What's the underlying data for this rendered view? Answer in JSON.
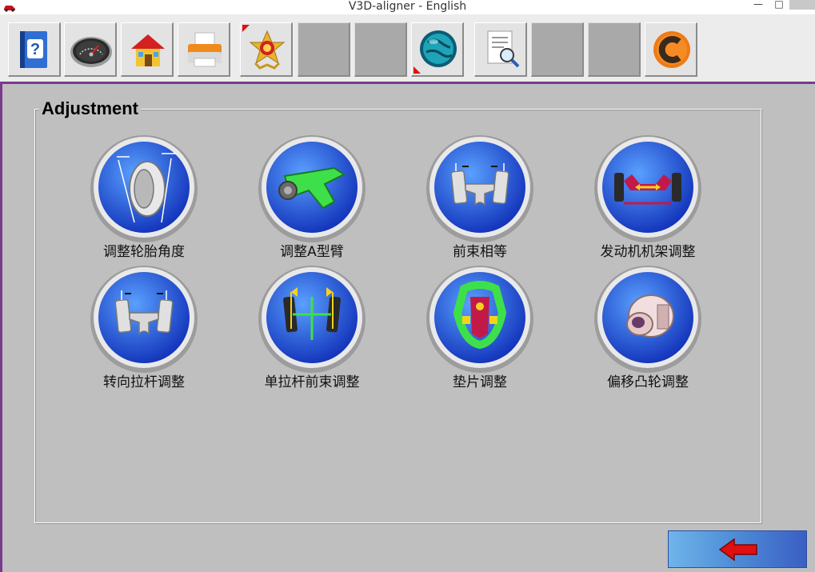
{
  "window": {
    "title": "V3D-aligner - English",
    "controls": {
      "minimize": "—",
      "maximize": "□",
      "close": ""
    }
  },
  "toolbar": {
    "buttons": [
      {
        "icon": "help-book-icon"
      },
      {
        "icon": "gauge-icon"
      },
      {
        "icon": "home-icon"
      },
      {
        "icon": "printer-icon"
      },
      {
        "icon": "badge-star-icon"
      },
      {
        "icon": "blank"
      },
      {
        "icon": "blank"
      },
      {
        "icon": "globe-icon"
      },
      {
        "icon": "report-search-icon"
      },
      {
        "icon": "blank"
      },
      {
        "icon": "blank"
      },
      {
        "icon": "c-logo-icon"
      }
    ]
  },
  "adjustment": {
    "title": "Adjustment",
    "items": [
      {
        "label": "调整轮胎角度",
        "icon": "tire-angle-icon"
      },
      {
        "label": "调整A型臂",
        "icon": "a-arm-icon"
      },
      {
        "label": "前束相等",
        "icon": "toe-equal-icon"
      },
      {
        "label": "发动机机架调整",
        "icon": "engine-cradle-icon"
      },
      {
        "label": "转向拉杆调整",
        "icon": "tie-rod-icon"
      },
      {
        "label": "单拉杆前束调整",
        "icon": "single-tie-rod-icon"
      },
      {
        "label": "垫片调整",
        "icon": "shim-icon"
      },
      {
        "label": "偏移凸轮调整",
        "icon": "cam-bolt-icon"
      }
    ]
  },
  "navigation": {
    "back_icon": "back-arrow-icon"
  },
  "colors": {
    "disc_blue": "#1f4fd6",
    "toolbar_bg": "#ececec",
    "content_bg": "#bfbfbf",
    "accent_purple": "#7a3a8e",
    "back_arrow_red": "#e01010"
  }
}
